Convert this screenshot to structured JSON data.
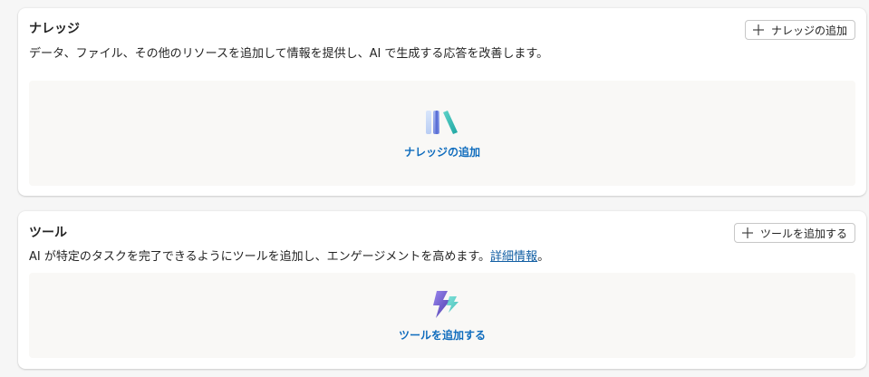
{
  "knowledge": {
    "title": "ナレッジ",
    "description": "データ、ファイル、その他のリソースを追加して情報を提供し、AI で生成する応答を改善します。",
    "add_button_label": "ナレッジの追加",
    "empty_link_label": "ナレッジの追加",
    "icon": "books-icon"
  },
  "tools": {
    "title": "ツール",
    "description_prefix": "AI が特定のタスクを完了できるようにツールを追加し、エンゲージメントを高めます。",
    "learn_more_link": "詳細情報",
    "description_suffix": "。",
    "add_button_label": "ツールを追加する",
    "empty_link_label": "ツールを追加する",
    "icon": "lightning-icon"
  },
  "colors": {
    "link": "#0f6cbd",
    "accent_teal": "#2fb5b0",
    "accent_purple": "#7a5bd6",
    "empty_bg": "#f9f8f6"
  }
}
